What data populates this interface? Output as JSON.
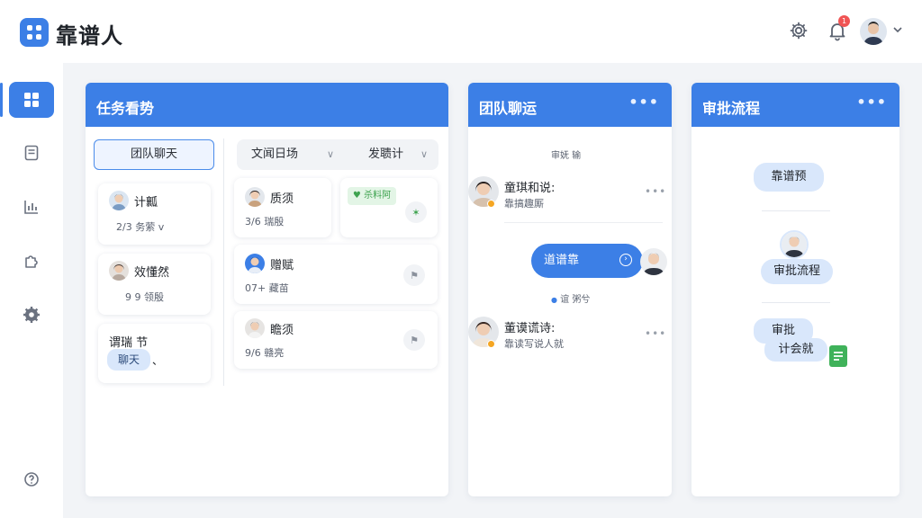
{
  "app": {
    "brand": "靠谱人",
    "notification_count": "1"
  },
  "icons": {
    "logo": "grid-logo-icon",
    "settings": "gear-icon",
    "notifications": "bell-icon",
    "user_menu": "chevron-down-icon",
    "sidebar": [
      "dashboard-icon",
      "document-icon",
      "chart-icon",
      "puzzle-icon",
      "settings-icon",
      "help-icon"
    ]
  },
  "colors": {
    "primary": "#3c7fe6",
    "chip": "#d9e7fb",
    "green": "#3ea34f",
    "badge": "#f05454",
    "online": "#f5a623"
  },
  "kanban": {
    "title": "任务看势",
    "selected_tab": "团队聊天",
    "filters": [
      "文闻日场",
      "发聩计"
    ],
    "left_cards": [
      {
        "name": "计瓤",
        "meta": "2/3 务萦 v"
      },
      {
        "name": "效懂然",
        "meta": "9 9 领殷"
      },
      {
        "name": "谓瑞 节",
        "chip": "聊天",
        "mark": "、"
      }
    ],
    "right_cards": [
      {
        "name": "质须",
        "meta": "3/6 瑞殷"
      },
      {
        "name": "赠赋",
        "meta": "07+ 藏苗"
      },
      {
        "name": "瞻须",
        "meta": "9/6 赣亮"
      }
    ],
    "status_tag": "♥ 杀料阿"
  },
  "chat": {
    "title": "团队聊运",
    "date_label": "审妩  输",
    "messages": [
      {
        "name": "童琪和说:",
        "text": "靠搞趣厮"
      },
      {
        "name": "董谟谎诗:",
        "text": "靠读写说人就"
      }
    ],
    "bubble_text": "道谱靠",
    "read_status": "谊  粥兮"
  },
  "approval": {
    "title": "审批流程",
    "bubble_top": "靠谱预",
    "bubble_mid": "审批流程",
    "bubble_bottom_line1": "审批",
    "bubble_bottom_line2": "计会就"
  }
}
